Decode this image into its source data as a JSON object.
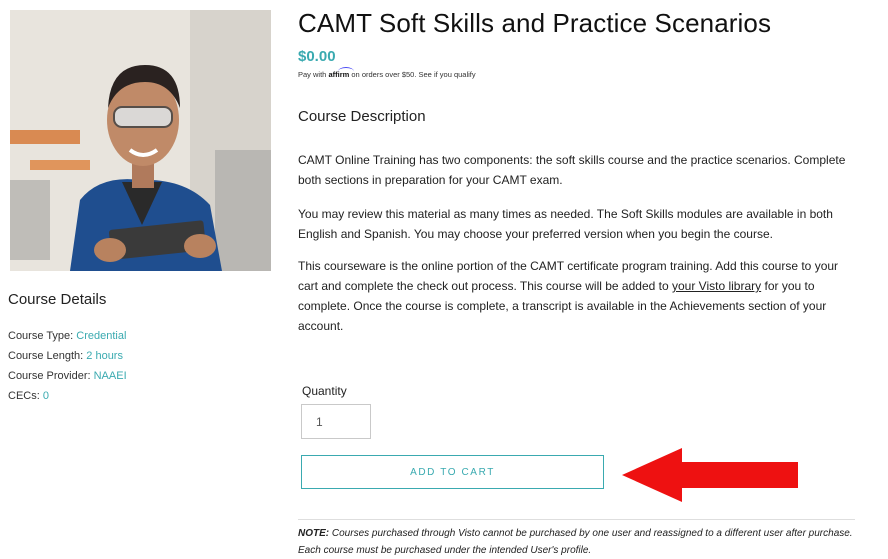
{
  "colors": {
    "accent": "#3aaab0",
    "arrow": "#ee1111"
  },
  "product": {
    "title": "CAMT Soft Skills and Practice Scenarios",
    "price": "$0.00",
    "affirm": {
      "prefix": "Pay with",
      "brand": "affirm",
      "suffix": "on orders over $50. See if you qualify"
    }
  },
  "description": {
    "heading": "Course Description",
    "p1": "CAMT Online Training has two components: the soft skills course and the practice scenarios. Complete both sections in preparation for your CAMT exam.",
    "p2": "You may review this material as many times as needed. The Soft Skills modules are available in both English and Spanish. You may choose your preferred version when you begin the course.",
    "p3_before": "This courseware is the online portion of the CAMT certificate program training. Add this course to your cart and complete the check out process. This course will be added to",
    "p3_link": "your Visto library",
    "p3_after": "for you to complete. Once the course is complete, a transcript is available in the Achievements section of your account."
  },
  "details": {
    "heading": "Course Details",
    "items": [
      {
        "label": "Course Type:",
        "value": "Credential"
      },
      {
        "label": "Course Length:",
        "value": "2 hours"
      },
      {
        "label": "Course Provider:",
        "value": "NAAEI"
      },
      {
        "label": "CECs:",
        "value": "0"
      }
    ]
  },
  "cart": {
    "quantity_label": "Quantity",
    "quantity_value": "1",
    "button_label": "ADD TO CART"
  },
  "note": {
    "label": "NOTE:",
    "text": "Courses purchased through Visto cannot be purchased by one user and reassigned to a different user after purchase. Each course must be purchased under the intended User's profile."
  }
}
